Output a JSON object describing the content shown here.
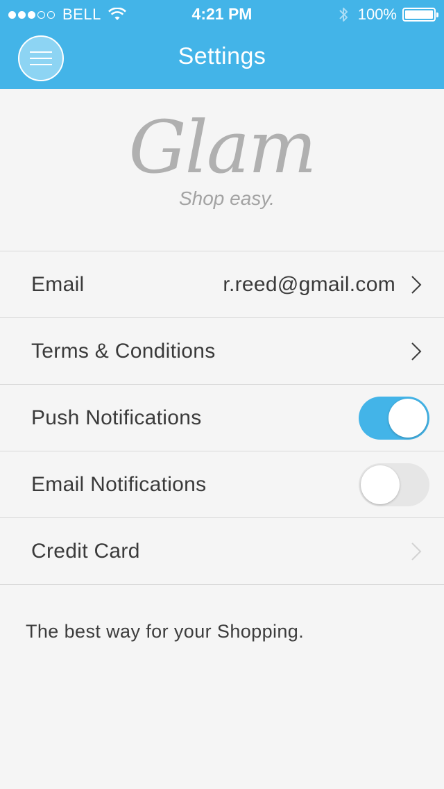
{
  "status_bar": {
    "signal_dots_filled": 3,
    "signal_dots_total": 5,
    "carrier": "BELL",
    "time": "4:21 PM",
    "battery": "100%"
  },
  "header": {
    "title": "Settings",
    "menu_icon": "hamburger-menu-icon",
    "color": "#43b4e8"
  },
  "logo": {
    "brand": "Glam",
    "tagline": "Shop easy."
  },
  "settings": {
    "email": {
      "label": "Email",
      "value": "r.reed@gmail.com"
    },
    "terms": {
      "label": "Terms & Conditions"
    },
    "push": {
      "label": "Push Notifications",
      "enabled": true
    },
    "email_notifications": {
      "label": "Email Notifications",
      "enabled": false
    },
    "credit_card": {
      "label": "Credit Card"
    }
  },
  "footer": {
    "text": "The best way for your Shopping."
  }
}
